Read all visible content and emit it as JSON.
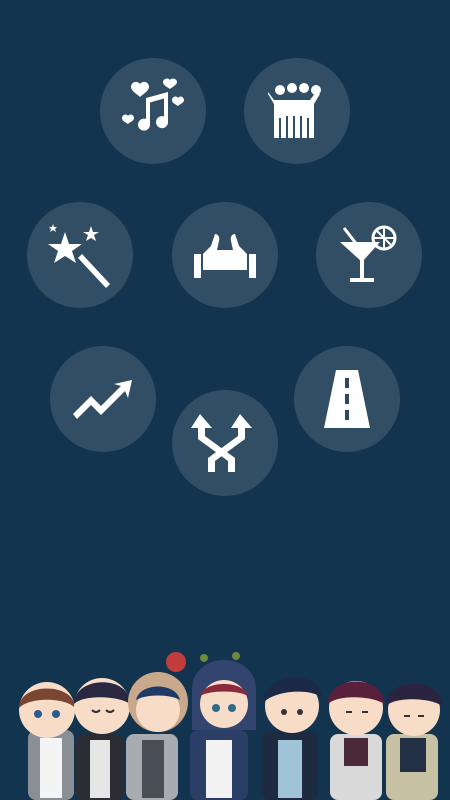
{
  "screen": {
    "background": "#13344f",
    "circle_fill": "rgba(255,255,255,0.13)",
    "icon_color": "#ffffff"
  },
  "menu": {
    "buttons": [
      {
        "id": "love-songs",
        "icon": "hearts-music-note-icon"
      },
      {
        "id": "friends",
        "icon": "group-hug-icon"
      },
      {
        "id": "magic",
        "icon": "magic-wand-stars-icon"
      },
      {
        "id": "favorites",
        "icon": "two-thumbs-up-icon"
      },
      {
        "id": "party",
        "icon": "cocktail-glass-icon"
      },
      {
        "id": "trending",
        "icon": "trending-up-arrow-icon"
      },
      {
        "id": "shuffle",
        "icon": "shuffle-arrows-icon"
      },
      {
        "id": "road",
        "icon": "road-icon"
      }
    ]
  },
  "footer": {
    "illustration": "chibi-band-members-illustration"
  }
}
